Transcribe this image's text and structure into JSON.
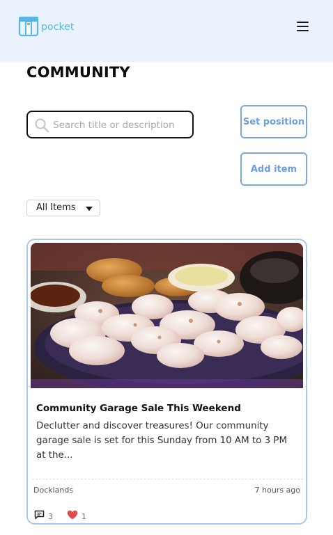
{
  "app": {
    "logo_text": "pocket"
  },
  "page": {
    "title": "COMMUNITY"
  },
  "search": {
    "placeholder": "Search title or description",
    "value": ""
  },
  "buttons": {
    "set_position": "Set position",
    "add_item": "Add item"
  },
  "filter": {
    "selected": "All Items"
  },
  "colors": {
    "header_bg": "#eaf3fd",
    "accent": "#6c9ee0",
    "card_border": "#a8c8ef",
    "like": "#e04b4b"
  },
  "posts": [
    {
      "title": "Community Garage Sale This Weekend",
      "description": "Declutter and discover treasures! Our community garage sale is set for this Sunday from 10 AM to 3 PM at the...",
      "location": "Docklands",
      "time": "7 hours ago",
      "comments": "3",
      "likes": "1",
      "image_icon": "food-photo"
    }
  ]
}
